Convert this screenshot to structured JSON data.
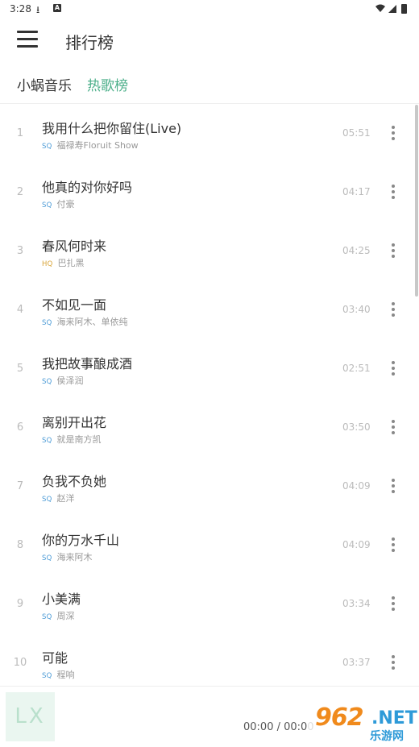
{
  "status": {
    "time": "3:28"
  },
  "header": {
    "title": "排行榜"
  },
  "tabs": {
    "source": "小蜗音乐",
    "board": "热歌榜"
  },
  "songs": [
    {
      "index": "1",
      "title": "我用什么把你留住(Live)",
      "quality": "SQ",
      "artist": "福禄寿Floruit Show",
      "duration": "05:51"
    },
    {
      "index": "2",
      "title": "他真的对你好吗",
      "quality": "SQ",
      "artist": "付豪",
      "duration": "04:17"
    },
    {
      "index": "3",
      "title": "春风何时来",
      "quality": "HQ",
      "artist": "巴扎黑",
      "duration": "04:25"
    },
    {
      "index": "4",
      "title": "不如见一面",
      "quality": "SQ",
      "artist": "海来阿木、单依纯",
      "duration": "03:40"
    },
    {
      "index": "5",
      "title": "我把故事酿成酒",
      "quality": "SQ",
      "artist": "侯泽润",
      "duration": "02:51"
    },
    {
      "index": "6",
      "title": "离别开出花",
      "quality": "SQ",
      "artist": "就是南方凯",
      "duration": "03:50"
    },
    {
      "index": "7",
      "title": "负我不负她",
      "quality": "SQ",
      "artist": "赵洋",
      "duration": "04:09"
    },
    {
      "index": "8",
      "title": "你的万水千山",
      "quality": "SQ",
      "artist": "海来阿木",
      "duration": "04:09"
    },
    {
      "index": "9",
      "title": "小美满",
      "quality": "SQ",
      "artist": "周深",
      "duration": "03:34"
    },
    {
      "index": "10",
      "title": "可能",
      "quality": "SQ",
      "artist": "程响",
      "duration": "03:37"
    }
  ],
  "player": {
    "cover_text": "LX",
    "time": "00:00 / 00:00"
  },
  "watermark": {
    "number": "962",
    "net": ".NET",
    "cn": "乐游网"
  },
  "colors": {
    "accent": "#4caf8a",
    "sq": "#4a9ad6",
    "hq": "#d9a53a"
  }
}
